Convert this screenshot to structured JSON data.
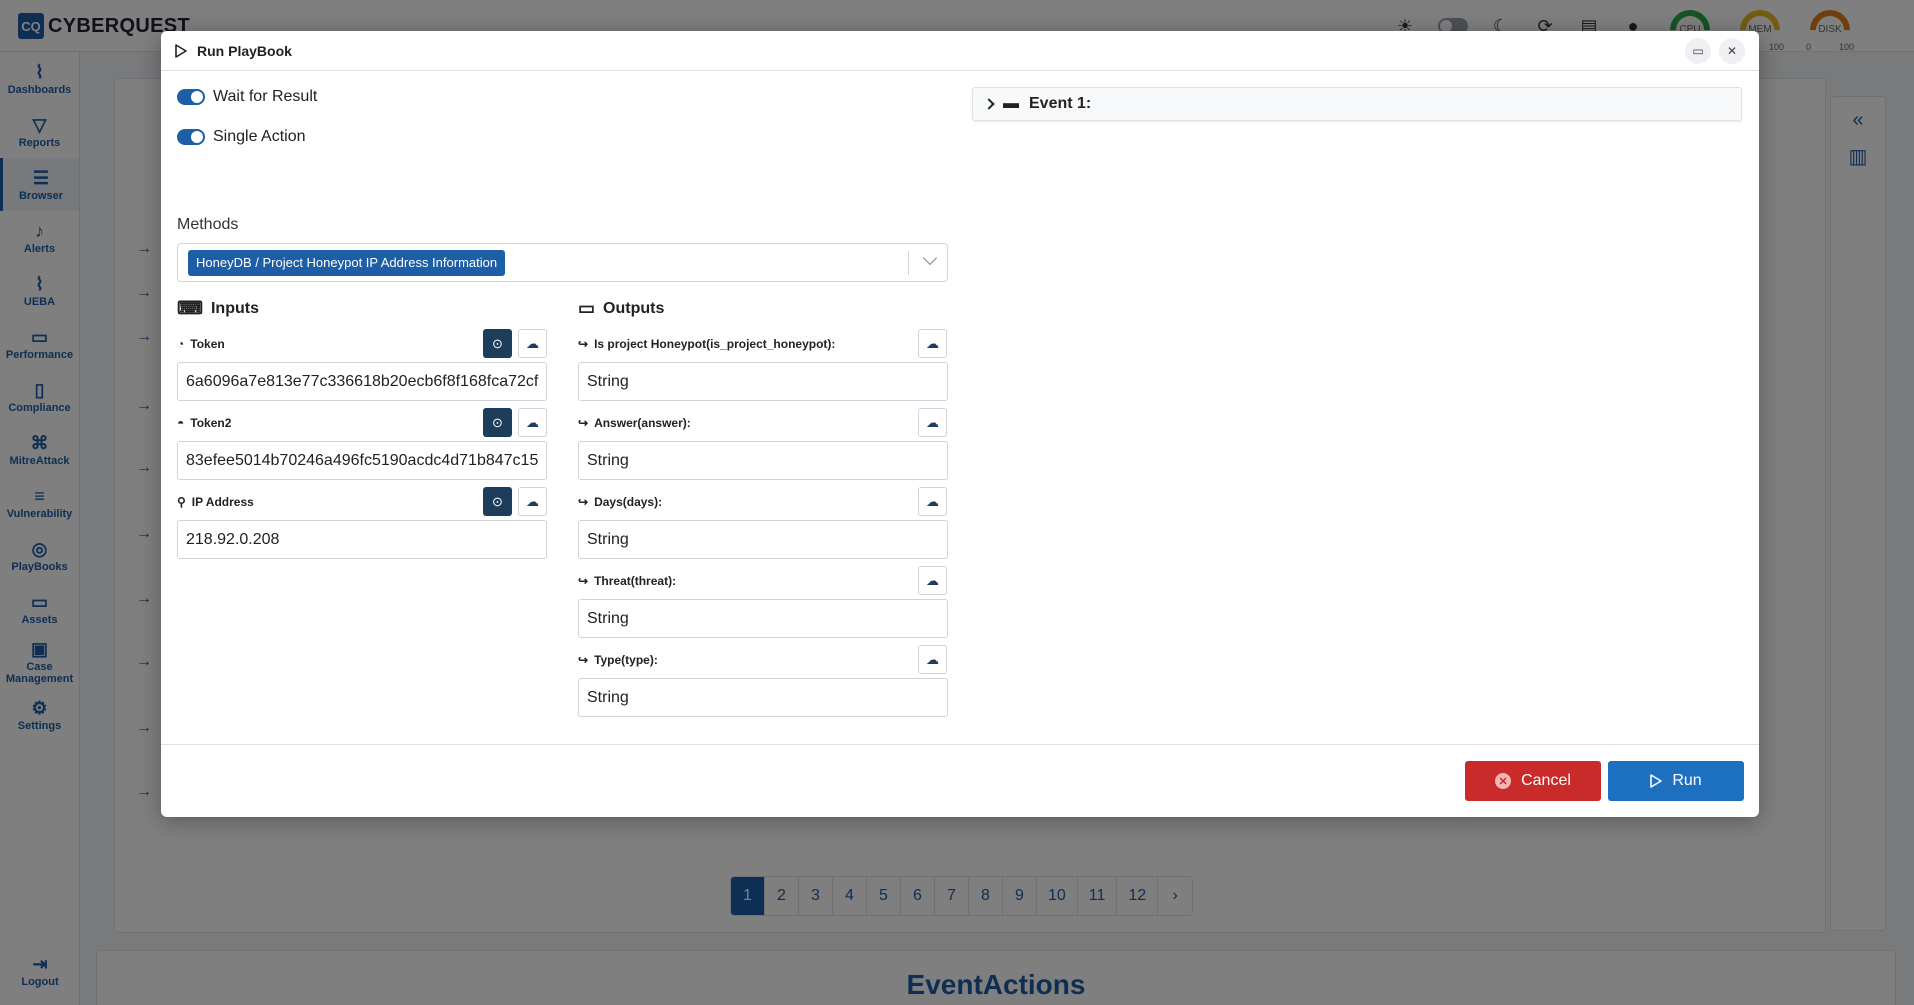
{
  "app": {
    "logo_mark": "CQ",
    "logo_text": "CYBERQUEST",
    "gauges": [
      {
        "label": "CPU",
        "min": "",
        "max": ""
      },
      {
        "label": "MEM",
        "min": "",
        "max": "100"
      },
      {
        "label": "DISK",
        "min": "0",
        "max": "100"
      }
    ]
  },
  "sidebar": {
    "items": [
      {
        "label": "Dashboards",
        "icon": "chart-line-icon"
      },
      {
        "label": "Reports",
        "icon": "filter-icon"
      },
      {
        "label": "Browser",
        "icon": "list-icon"
      },
      {
        "label": "Alerts",
        "icon": "bell-icon"
      },
      {
        "label": "UEBA",
        "icon": "chart-icon"
      },
      {
        "label": "Performance",
        "icon": "keyboard-icon"
      },
      {
        "label": "Compliance",
        "icon": "document-icon"
      },
      {
        "label": "MitreAttack",
        "icon": "command-icon"
      },
      {
        "label": "Vulnerability",
        "icon": "server-icon"
      },
      {
        "label": "PlayBooks",
        "icon": "playbook-icon"
      },
      {
        "label": "Assets",
        "icon": "laptop-icon"
      },
      {
        "label": "Case Management",
        "icon": "briefcase-icon"
      },
      {
        "label": "Settings",
        "icon": "gear-icon"
      }
    ],
    "logout": "Logout"
  },
  "background": {
    "pages": [
      "1",
      "2",
      "3",
      "4",
      "5",
      "6",
      "7",
      "8",
      "9",
      "10",
      "11",
      "12",
      "›"
    ],
    "active_page": "1",
    "lower_title": "EventActions"
  },
  "modal": {
    "title": "Run PlayBook",
    "wait_for_result_label": "Wait for Result",
    "single_action_label": "Single Action",
    "methods_label": "Methods",
    "selected_method": "HoneyDB / Project Honeypot IP Address Information",
    "inputs_title": "Inputs",
    "outputs_title": "Outputs",
    "inputs": [
      {
        "label": "Token",
        "value": "6a6096a7e813e77c336618b20ecb6f8f168fca72cf"
      },
      {
        "label": "Token2",
        "value": "83efee5014b70246a496fc5190acdc4d71b847c15"
      },
      {
        "label": "IP Address",
        "value": "218.92.0.208"
      }
    ],
    "outputs": [
      {
        "label": "Is project Honeypot(is_project_honeypot):",
        "value": "String"
      },
      {
        "label": "Answer(answer):",
        "value": "String"
      },
      {
        "label": "Days(days):",
        "value": "String"
      },
      {
        "label": "Threat(threat):",
        "value": "String"
      },
      {
        "label": "Type(type):",
        "value": "String"
      }
    ],
    "event_label": "Event 1:",
    "cancel_label": "Cancel",
    "run_label": "Run"
  },
  "colors": {
    "primary": "#1d5fa6",
    "cancel": "#c92a2a",
    "run": "#1d6fbf",
    "dark_button": "#1e3d5c"
  }
}
